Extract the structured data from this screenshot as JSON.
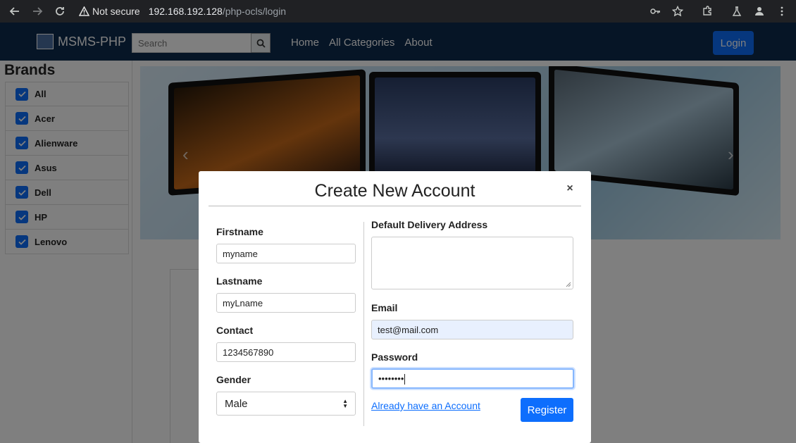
{
  "browser": {
    "security_label": "Not secure",
    "url_host": "192.168.192.128",
    "url_path": "/php-ocls/login"
  },
  "nav": {
    "brand": "MSMS-PHP",
    "search_placeholder": "Search",
    "links": [
      "Home",
      "All Categories",
      "About"
    ],
    "login": "Login"
  },
  "sidebar": {
    "title": "Brands",
    "items": [
      "All",
      "Acer",
      "Alienware",
      "Asus",
      "Dell",
      "HP",
      "Lenovo"
    ]
  },
  "modal": {
    "title": "Create New Account",
    "close": "×",
    "left": {
      "firstname_label": "Firstname",
      "firstname_value": "myname",
      "lastname_label": "Lastname",
      "lastname_value": "myLname",
      "contact_label": "Contact",
      "contact_value": "1234567890",
      "gender_label": "Gender",
      "gender_value": "Male"
    },
    "right": {
      "address_label": "Default Delivery Address",
      "address_value": "",
      "email_label": "Email",
      "email_value": "test@mail.com",
      "password_label": "Password",
      "password_value": "••••••••",
      "already_link": "Already have an Account",
      "register": "Register"
    }
  },
  "colors": {
    "nav_bg": "#0d2a4d",
    "primary": "#0d6efd"
  }
}
